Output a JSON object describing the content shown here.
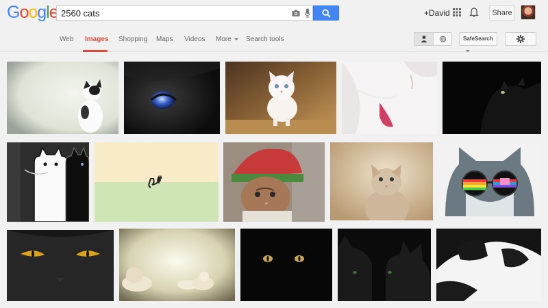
{
  "logo": {
    "letters": [
      "G",
      "o",
      "o",
      "g",
      "l",
      "e"
    ],
    "colors": [
      "#4285f4",
      "#ea4335",
      "#fbbc05",
      "#4285f4",
      "#34a853",
      "#ea4335"
    ]
  },
  "search": {
    "value": "2560 cats"
  },
  "header": {
    "user_label": "+David",
    "share_label": "Share"
  },
  "nav": {
    "tabs": [
      {
        "label": "Web"
      },
      {
        "label": "Images"
      },
      {
        "label": "Shopping"
      },
      {
        "label": "Maps"
      },
      {
        "label": "Videos"
      },
      {
        "label": "More"
      },
      {
        "label": "Search tools"
      }
    ],
    "active_tab": "Images",
    "safesearch_label": "SafeSearch"
  },
  "colors": {
    "accent": "#dd4b39",
    "search_blue": "#4285f4"
  },
  "results": [
    {
      "subject": "white and black cat sitting, looking right"
    },
    {
      "subject": "black cat eye with earth reflection"
    },
    {
      "subject": "white kitten standing"
    },
    {
      "subject": "white cat close-up with pink nose"
    },
    {
      "subject": "black cat in darkness, yellow eye"
    },
    {
      "subject": "cartoon long white and black cats"
    },
    {
      "subject": "minimal cat silhouette on pastel background"
    },
    {
      "subject": "tabby kitten in red and green hat"
    },
    {
      "subject": "grey kitten looking up"
    },
    {
      "subject": "cat with rainbow space sunglasses"
    },
    {
      "subject": "black cat face with yellow eyes"
    },
    {
      "subject": "white lions resting"
    },
    {
      "subject": "black cat eyes in the dark"
    },
    {
      "subject": "two black cats in shadows"
    },
    {
      "subject": "black and white cat profile"
    }
  ]
}
